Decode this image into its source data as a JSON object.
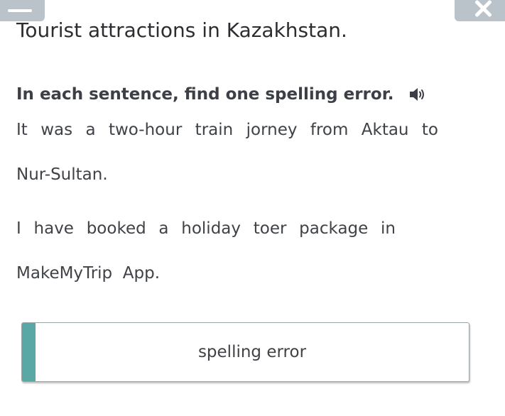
{
  "toolbar": {
    "menu_icon": "menu-icon",
    "close_icon": "close-icon",
    "button_color": "#b9c3c9"
  },
  "title": "Tourist attractions in Kazakhstan.",
  "instruction": {
    "text": "In each sentence, find one spelling error.",
    "audio_icon": "speaker-icon"
  },
  "sentences": [
    {
      "line1": "It was a two-hour train jorney from Aktau to",
      "line2": "Nur-Sultan."
    },
    {
      "line1": "I have booked a holiday toer package in",
      "line2": "MakeMyTrip  App."
    }
  ],
  "answer": {
    "placeholder": "spelling error",
    "accent_color": "#5aa8a6"
  }
}
